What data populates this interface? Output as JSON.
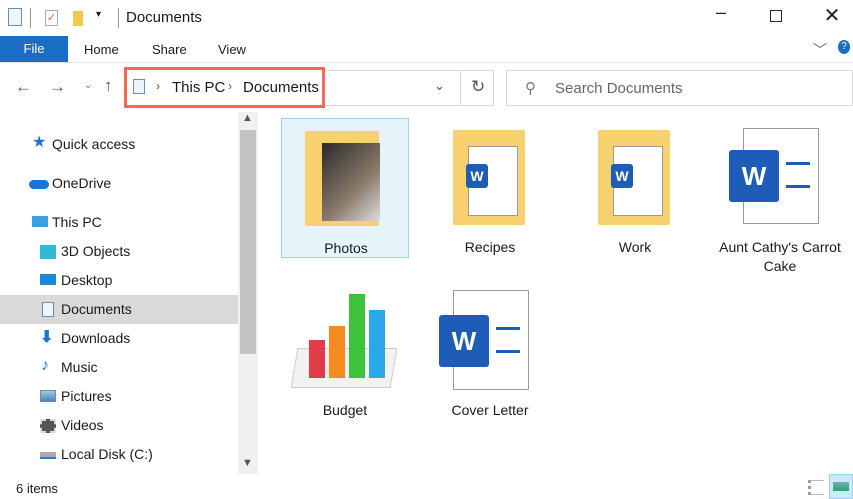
{
  "title": "Documents",
  "ribbon": {
    "file": "File",
    "tabs": [
      "Home",
      "Share",
      "View"
    ]
  },
  "address": {
    "crumbs": [
      "This PC",
      "Documents"
    ]
  },
  "search": {
    "placeholder": "Search Documents"
  },
  "nav": [
    {
      "label": "Quick access",
      "icon": "star-icon",
      "color": "#1a73d9"
    },
    {
      "label": "OneDrive",
      "icon": "cloud-icon",
      "color": "#1a73d9"
    },
    {
      "label": "This PC",
      "icon": "computer-icon",
      "color": "#3aa0e0"
    },
    {
      "label": "3D Objects",
      "icon": "cube-icon",
      "color": "#2fb8d8"
    },
    {
      "label": "Desktop",
      "icon": "desktop-icon",
      "color": "#1a8ad9"
    },
    {
      "label": "Documents",
      "icon": "document-icon",
      "color": "#7aa0c8",
      "selected": true
    },
    {
      "label": "Downloads",
      "icon": "download-arrow-icon",
      "color": "#1a73d9"
    },
    {
      "label": "Music",
      "icon": "music-note-icon",
      "color": "#1a73d9"
    },
    {
      "label": "Pictures",
      "icon": "pictures-icon",
      "color": "#4a8ab8"
    },
    {
      "label": "Videos",
      "icon": "film-icon",
      "color": "#555"
    },
    {
      "label": "Local Disk (C:)",
      "icon": "drive-icon",
      "color": "#777"
    }
  ],
  "items": [
    {
      "name": "Photos",
      "type": "folder",
      "selected": true
    },
    {
      "name": "Recipes",
      "type": "folder"
    },
    {
      "name": "Work",
      "type": "folder"
    },
    {
      "name": "Aunt Cathy's Carrot Cake",
      "type": "word"
    },
    {
      "name": "Budget",
      "type": "numbers"
    },
    {
      "name": "Cover Letter",
      "type": "word"
    }
  ],
  "status": {
    "count": "6 items"
  },
  "colors": {
    "accent": "#1a6dc4",
    "highlight": "#f26d4e"
  }
}
